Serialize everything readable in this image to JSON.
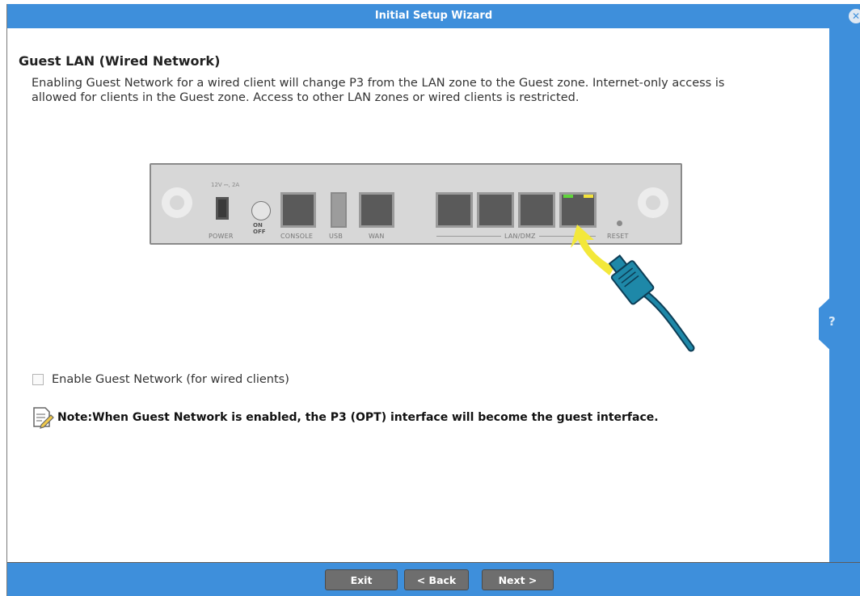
{
  "window": {
    "title": "Initial Setup Wizard"
  },
  "page": {
    "heading": "Guest LAN (Wired Network)",
    "description": "Enabling Guest Network for a wired client will change P3 from the LAN zone to the Guest zone. Internet-only access is allowed for clients in the Guest zone. Access to other LAN zones or wired clients is restricted."
  },
  "device": {
    "power_rating": "12V ⎓, 2A",
    "labels": {
      "power": "POWER",
      "on": "ON",
      "off": "OFF",
      "console": "CONSOLE",
      "usb": "USB",
      "wan": "WAN",
      "lan_dmz": "LAN/DMZ",
      "reset": "RESET"
    }
  },
  "option": {
    "enable_guest_label": "Enable Guest Network (for wired clients)",
    "checked": false
  },
  "note": {
    "text": "Note:When Guest Network is enabled, the P3 (OPT) interface will become the guest interface."
  },
  "help": {
    "label": "?"
  },
  "footer": {
    "exit_label": "Exit",
    "back_label": "< Back",
    "next_label": "Next >"
  },
  "colors": {
    "accent": "#3e8fdb",
    "button": "#6e6e6e",
    "arrow": "#f3e83a",
    "cable": "#1e88a8"
  }
}
